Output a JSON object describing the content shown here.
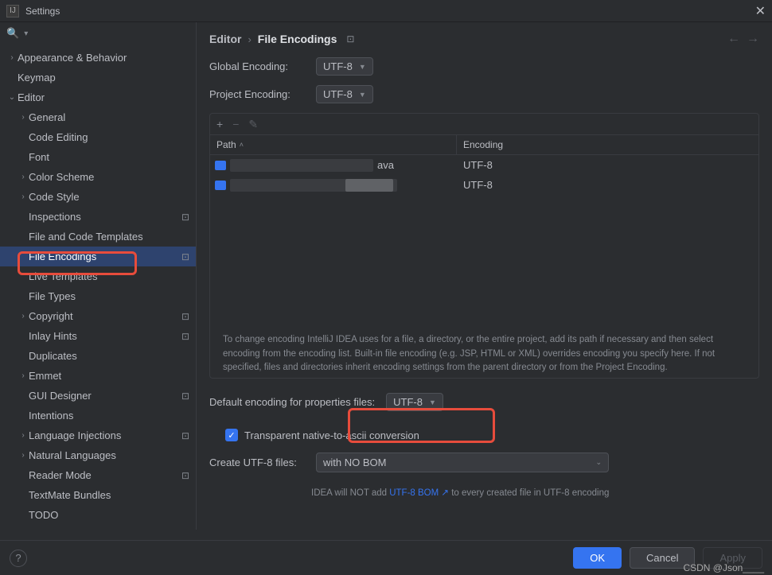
{
  "window": {
    "title": "Settings"
  },
  "nav": {
    "back": "←",
    "fwd": "→"
  },
  "tree": [
    {
      "label": "Appearance & Behavior",
      "lvl": 0,
      "chev": "›"
    },
    {
      "label": "Keymap",
      "lvl": 0,
      "chev": ""
    },
    {
      "label": "Editor",
      "lvl": 0,
      "chev": "⌄",
      "expanded": true
    },
    {
      "label": "General",
      "lvl": 1,
      "chev": "›"
    },
    {
      "label": "Code Editing",
      "lvl": 1,
      "chev": ""
    },
    {
      "label": "Font",
      "lvl": 1,
      "chev": ""
    },
    {
      "label": "Color Scheme",
      "lvl": 1,
      "chev": "›"
    },
    {
      "label": "Code Style",
      "lvl": 1,
      "chev": "›"
    },
    {
      "label": "Inspections",
      "lvl": 1,
      "chev": "",
      "badge": "⊡"
    },
    {
      "label": "File and Code Templates",
      "lvl": 1,
      "chev": ""
    },
    {
      "label": "File Encodings",
      "lvl": 1,
      "chev": "",
      "badge": "⊡",
      "selected": true
    },
    {
      "label": "Live Templates",
      "lvl": 1,
      "chev": ""
    },
    {
      "label": "File Types",
      "lvl": 1,
      "chev": ""
    },
    {
      "label": "Copyright",
      "lvl": 1,
      "chev": "›",
      "badge": "⊡"
    },
    {
      "label": "Inlay Hints",
      "lvl": 1,
      "chev": "",
      "badge": "⊡"
    },
    {
      "label": "Duplicates",
      "lvl": 1,
      "chev": ""
    },
    {
      "label": "Emmet",
      "lvl": 1,
      "chev": "›"
    },
    {
      "label": "GUI Designer",
      "lvl": 1,
      "chev": "",
      "badge": "⊡"
    },
    {
      "label": "Intentions",
      "lvl": 1,
      "chev": ""
    },
    {
      "label": "Language Injections",
      "lvl": 1,
      "chev": "›",
      "badge": "⊡"
    },
    {
      "label": "Natural Languages",
      "lvl": 1,
      "chev": "›"
    },
    {
      "label": "Reader Mode",
      "lvl": 1,
      "chev": "",
      "badge": "⊡"
    },
    {
      "label": "TextMate Bundles",
      "lvl": 1,
      "chev": ""
    },
    {
      "label": "TODO",
      "lvl": 1,
      "chev": ""
    }
  ],
  "breadcrumb": {
    "a": "Editor",
    "b": "File Encodings"
  },
  "fields": {
    "global_label": "Global Encoding:",
    "global_value": "UTF-8",
    "project_label": "Project Encoding:",
    "project_value": "UTF-8",
    "props_label": "Default encoding for properties files:",
    "props_value": "UTF-8",
    "bom_label": "Create UTF-8 files:",
    "bom_value": "with NO BOM"
  },
  "table": {
    "path_header": "Path",
    "enc_header": "Encoding",
    "rows": [
      {
        "suffix": "ava",
        "encoding": "UTF-8"
      },
      {
        "suffix": "",
        "encoding": "UTF-8"
      }
    ]
  },
  "hint": "To change encoding IntelliJ IDEA uses for a file, a directory, or the entire project, add its path if necessary and then select encoding from the encoding list. Built-in file encoding (e.g. JSP, HTML or XML) overrides encoding you specify here. If not specified, files and directories inherit encoding settings from the parent directory or from the Project Encoding.",
  "checkbox_label": "Transparent native-to-ascii conversion",
  "bom_hint": {
    "pre": "IDEA will NOT add ",
    "link": "UTF-8 BOM ↗",
    "post": " to every created file in UTF-8 encoding"
  },
  "buttons": {
    "ok": "OK",
    "cancel": "Cancel",
    "apply": "Apply"
  },
  "watermark": "CSDN @Json____"
}
